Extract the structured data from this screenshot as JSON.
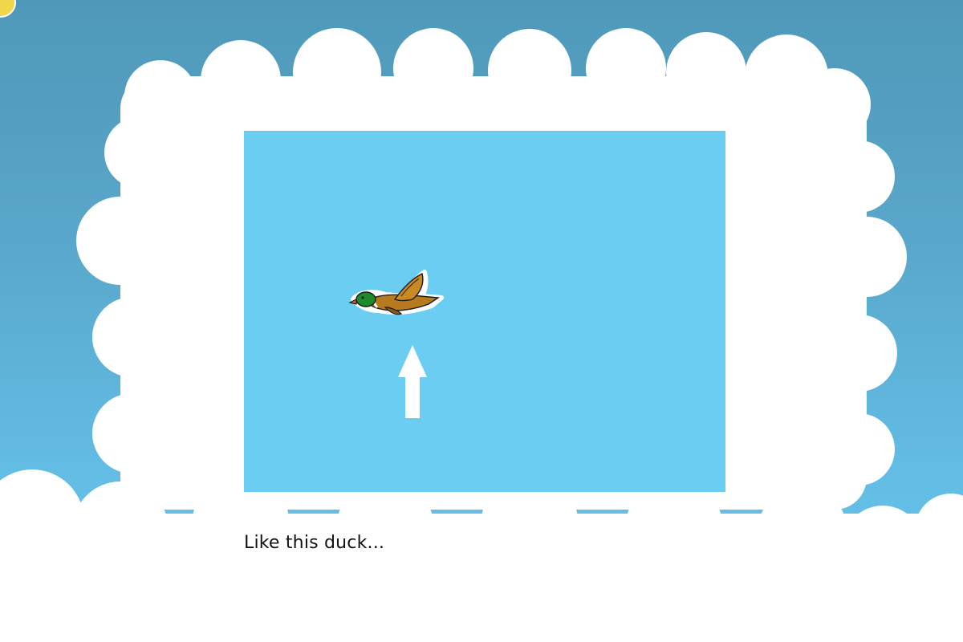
{
  "scene": {
    "caption": "Like this duck...",
    "colors": {
      "sky_top": "#4f98b9",
      "sky_bottom": "#66c4eb",
      "cloud": "#ffffff",
      "panel_sky": "#6ccdf2",
      "arrow": "#ffffff"
    },
    "icons": {
      "sprite": "flying-mallard-duck-icon",
      "direction": "up-arrow-icon",
      "decor": "sun-icon"
    }
  }
}
